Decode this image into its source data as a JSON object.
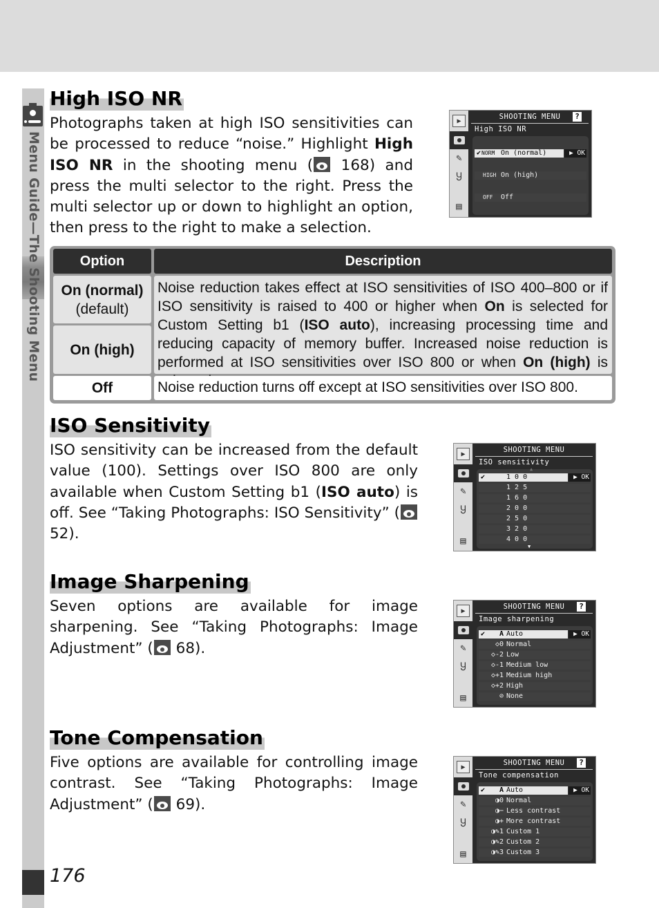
{
  "page": {
    "number": "176",
    "side_label": "Menu Guide—The Shooting Menu",
    "side_icon": "camera-icon"
  },
  "sections": {
    "high_iso_nr": {
      "title": "High ISO NR",
      "body": {
        "p1": "Photographs taken at high ISO sensitivities can be processed to reduce “noise.”  Highlight ",
        "b1": "High ISO NR",
        "p2": " in the shooting menu (",
        "ref": "168",
        "p3": ") and press the multi selector to the right.  Press the multi selector up or down to highlight an option, then press to the right to make a selection."
      },
      "table": {
        "headers": [
          "Option",
          "Description"
        ],
        "rows": [
          {
            "option": "On (normal)",
            "option_note": "(default)"
          },
          {
            "option": "On (high)"
          },
          {
            "option": "Off",
            "description": "Noise reduction turns off except at ISO sensitivities over ISO 800."
          }
        ],
        "shared_description": {
          "p1": "Noise reduction takes effect at ISO sensitivities of ISO 400–800 or if ISO sensitivity is raised to 400 or higher when ",
          "b1": "On",
          "p2": " is selected for Custom Setting b1 (",
          "b2": "ISO auto",
          "p3": "), increasing processing time and reducing capacity of memory buffer.  Increased noise reduction is performed at ISO sensitivities over ISO 800 or when ",
          "b3": "On (high)",
          "p4": " is selected."
        }
      },
      "screen": {
        "header": "SHOOTING MENU",
        "help": "?",
        "subtitle": "High ISO NR",
        "ok": "▶ OK",
        "items": [
          {
            "check": "✔",
            "code": "NORM",
            "label": "On (normal)",
            "selected": true
          },
          {
            "check": "",
            "code": "HIGH",
            "label": "On (high)",
            "selected": false
          },
          {
            "check": "",
            "code": "OFF",
            "label": "Off",
            "selected": false
          }
        ]
      }
    },
    "iso_sensitivity": {
      "title": "ISO Sensitivity",
      "body": {
        "p1": "ISO sensitivity can be increased from the default value (100).  Settings over ISO 800 are only available when Custom Setting b1 (",
        "b1": "ISO auto",
        "p2": ") is off.  See “Taking Photographs: ISO Sensitivity” (",
        "ref": "52",
        "p3": ")."
      },
      "screen": {
        "header": "SHOOTING MENU",
        "subtitle": "ISO sensitivity",
        "ok": "▶ OK",
        "scroll_up": "▲",
        "scroll_down": "▼",
        "items": [
          {
            "check": "✔",
            "label": "1 0 0",
            "selected": true
          },
          {
            "check": "",
            "label": "1 2 5"
          },
          {
            "check": "",
            "label": "1 6 0"
          },
          {
            "check": "",
            "label": "2 0 0"
          },
          {
            "check": "",
            "label": "2 5 0"
          },
          {
            "check": "",
            "label": "3 2 0"
          },
          {
            "check": "",
            "label": "4 0 0"
          }
        ]
      }
    },
    "image_sharpening": {
      "title": "Image Sharpening",
      "body": {
        "p1": "Seven options are available for image sharpening.  See “Taking Photographs: Image Adjustment” (",
        "ref": "68",
        "p2": ")."
      },
      "screen": {
        "header": "SHOOTING MENU",
        "help": "?",
        "subtitle": "Image sharpening",
        "ok": "▶ OK",
        "items": [
          {
            "check": "✔",
            "code": "A",
            "label": "Auto",
            "selected": true
          },
          {
            "check": "",
            "code": "◇0",
            "label": "Normal"
          },
          {
            "check": "",
            "code": "◇-2",
            "label": "Low"
          },
          {
            "check": "",
            "code": "◇-1",
            "label": "Medium low"
          },
          {
            "check": "",
            "code": "◇+1",
            "label": "Medium high"
          },
          {
            "check": "",
            "code": "◇+2",
            "label": "High"
          },
          {
            "check": "",
            "code": "⊘",
            "label": "None"
          }
        ]
      }
    },
    "tone_compensation": {
      "title": "Tone Compensation",
      "body": {
        "p1": "Five options are available for controlling image contrast.  See “Taking Photographs: Image Adjustment” (",
        "ref": "69",
        "p2": ")."
      },
      "screen": {
        "header": "SHOOTING MENU",
        "help": "?",
        "subtitle": "Tone compensation",
        "ok": "▶ OK",
        "items": [
          {
            "check": "✔",
            "code": "A",
            "label": "Auto",
            "selected": true
          },
          {
            "check": "",
            "code": "◑0",
            "label": "Normal"
          },
          {
            "check": "",
            "code": "◑−",
            "label": "Less contrast"
          },
          {
            "check": "",
            "code": "◑+",
            "label": "More contrast"
          },
          {
            "check": "",
            "code": "◑✎1",
            "label": "Custom 1"
          },
          {
            "check": "",
            "code": "◑✎2",
            "label": "Custom 2"
          },
          {
            "check": "",
            "code": "◑✎3",
            "label": "Custom 3"
          }
        ]
      }
    }
  },
  "lcd_side_icons": [
    "playback-icon",
    "camera-icon",
    "pencil-icon",
    "wrench-icon",
    "recent-settings-icon"
  ]
}
